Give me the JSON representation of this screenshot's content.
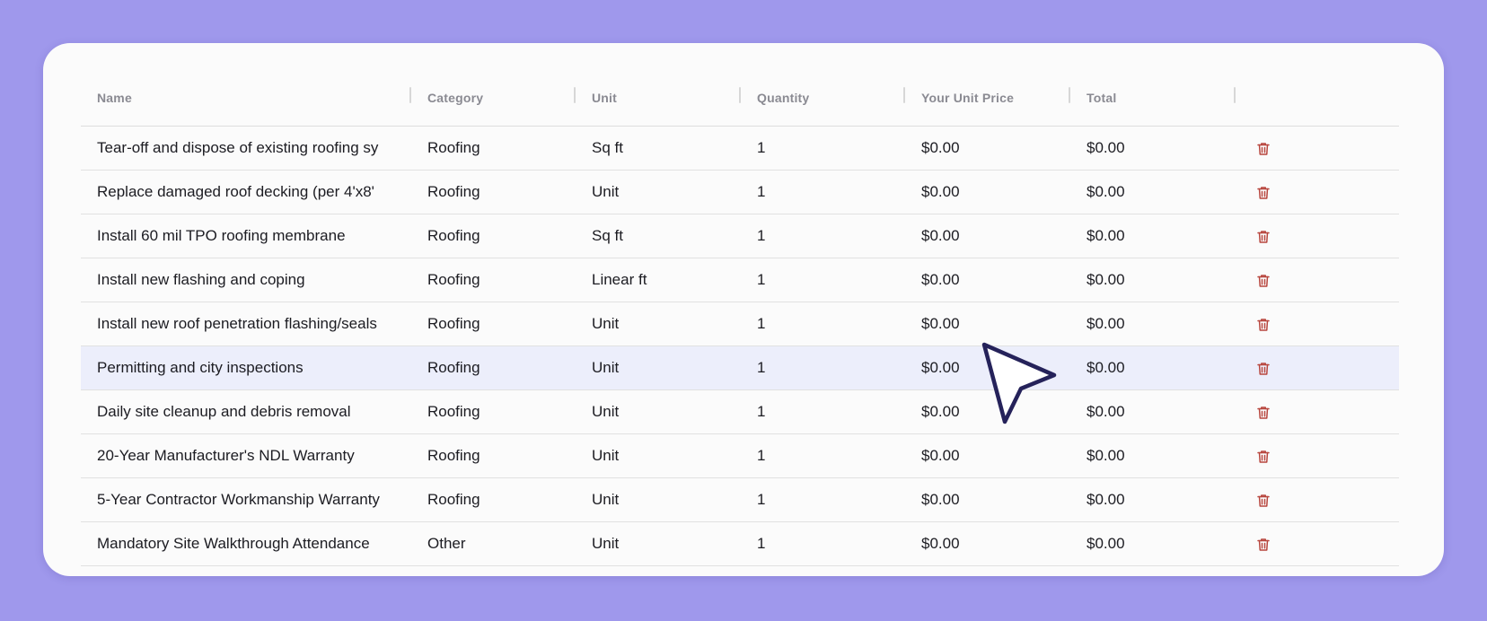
{
  "colors": {
    "background": "#9f98ec",
    "card": "#fbfbfb",
    "highlight_row": "#eceefb",
    "trash_icon": "#b8463e",
    "cursor_stroke": "#25225a"
  },
  "table": {
    "headers": {
      "name": "Name",
      "category": "Category",
      "unit": "Unit",
      "quantity": "Quantity",
      "unit_price": "Your Unit Price",
      "total": "Total"
    },
    "rows": [
      {
        "name": "Tear-off and dispose of existing roofing sy",
        "category": "Roofing",
        "unit": "Sq ft",
        "quantity": "1",
        "unit_price": "$0.00",
        "total": "$0.00",
        "delete_icon": "trash-icon"
      },
      {
        "name": "Replace damaged roof decking (per 4'x8'",
        "category": "Roofing",
        "unit": "Unit",
        "quantity": "1",
        "unit_price": "$0.00",
        "total": "$0.00",
        "delete_icon": "trash-icon"
      },
      {
        "name": "Install 60 mil TPO roofing membrane",
        "category": "Roofing",
        "unit": "Sq ft",
        "quantity": "1",
        "unit_price": "$0.00",
        "total": "$0.00",
        "delete_icon": "trash-icon"
      },
      {
        "name": "Install new flashing and coping",
        "category": "Roofing",
        "unit": "Linear ft",
        "quantity": "1",
        "unit_price": "$0.00",
        "total": "$0.00",
        "delete_icon": "trash-icon"
      },
      {
        "name": "Install new roof penetration flashing/seals",
        "category": "Roofing",
        "unit": "Unit",
        "quantity": "1",
        "unit_price": "$0.00",
        "total": "$0.00",
        "delete_icon": "trash-icon"
      },
      {
        "name": "Permitting and city inspections",
        "category": "Roofing",
        "unit": "Unit",
        "quantity": "1",
        "unit_price": "$0.00",
        "total": "$0.00",
        "delete_icon": "trash-icon"
      },
      {
        "name": "Daily site cleanup and debris removal",
        "category": "Roofing",
        "unit": "Unit",
        "quantity": "1",
        "unit_price": "$0.00",
        "total": "$0.00",
        "delete_icon": "trash-icon"
      },
      {
        "name": "20-Year Manufacturer's NDL Warranty",
        "category": "Roofing",
        "unit": "Unit",
        "quantity": "1",
        "unit_price": "$0.00",
        "total": "$0.00",
        "delete_icon": "trash-icon"
      },
      {
        "name": "5-Year Contractor Workmanship Warranty",
        "category": "Roofing",
        "unit": "Unit",
        "quantity": "1",
        "unit_price": "$0.00",
        "total": "$0.00",
        "delete_icon": "trash-icon"
      },
      {
        "name": "Mandatory Site Walkthrough Attendance",
        "category": "Other",
        "unit": "Unit",
        "quantity": "1",
        "unit_price": "$0.00",
        "total": "$0.00",
        "delete_icon": "trash-icon"
      }
    ],
    "highlighted_row": 5
  },
  "pointer_icon": "cursor-arrow-icon"
}
